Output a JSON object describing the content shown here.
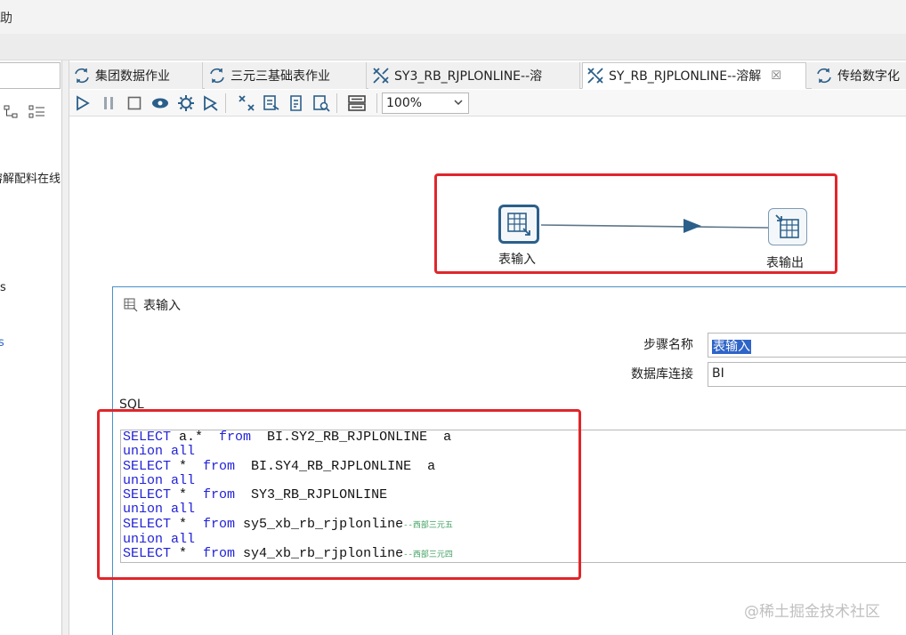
{
  "menu": {
    "help_fragment": "助"
  },
  "left_panel": {
    "tree_text_1": "溶解配料在线",
    "tree_text_2": "s",
    "tree_text_3": "s"
  },
  "tabs": [
    {
      "label": "集团数据作业",
      "icon": "job-icon",
      "active": false
    },
    {
      "label": "三元三基础表作业",
      "icon": "job-icon",
      "active": false
    },
    {
      "label": "SY3_RB_RJPLONLINE--溶",
      "icon": "transformation-icon",
      "active": false
    },
    {
      "label": "SY_RB_RJPLONLINE--溶解",
      "icon": "transformation-icon",
      "active": true,
      "close": "☒"
    },
    {
      "label": "传给数字化",
      "icon": "job-icon",
      "active": false
    }
  ],
  "toolbar": {
    "zoom": "100%"
  },
  "canvas": {
    "step_input_label": "表输入",
    "step_output_label": "表输出"
  },
  "dialog": {
    "title": "表输入",
    "step_name_label": "步骤名称",
    "step_name_value": "表输入",
    "db_conn_label": "数据库连接",
    "db_conn_value": "BI",
    "sql_label": "SQL",
    "sql_lines": [
      {
        "kw1": "SELECT",
        "t1": " a.*  ",
        "kw2": "from",
        "t2": "  BI.SY2_RB_RJPLONLINE  a",
        "comment": ""
      },
      {
        "kw1": "union all",
        "t1": "",
        "kw2": "",
        "t2": "",
        "comment": ""
      },
      {
        "kw1": "SELECT",
        "t1": " *  ",
        "kw2": "from",
        "t2": "  BI.SY4_RB_RJPLONLINE  a",
        "comment": ""
      },
      {
        "kw1": "union all",
        "t1": "",
        "kw2": "",
        "t2": "",
        "comment": ""
      },
      {
        "kw1": "SELECT",
        "t1": " *  ",
        "kw2": "from",
        "t2": "  SY3_RB_RJPLONLINE",
        "comment": ""
      },
      {
        "kw1": "union all",
        "t1": "",
        "kw2": "",
        "t2": "",
        "comment": ""
      },
      {
        "kw1": "SELECT",
        "t1": " *  ",
        "kw2": "from",
        "t2": " sy5_xb_rb_rjplonline",
        "comment": "--西部三元五"
      },
      {
        "kw1": "union all",
        "t1": "",
        "kw2": "",
        "t2": "",
        "comment": ""
      },
      {
        "kw1": "SELECT",
        "t1": " *  ",
        "kw2": "from",
        "t2": " sy4_xb_rb_rjplonline",
        "comment": "--西部三元四"
      }
    ]
  },
  "watermark": "@稀土掘金技术社区",
  "colors": {
    "highlight_red": "#e0262b",
    "step_blue": "#2b5f8a",
    "selection_blue": "#2f64c8",
    "sql_keyword": "#2222d8",
    "sql_comment": "#3f9f5f"
  }
}
